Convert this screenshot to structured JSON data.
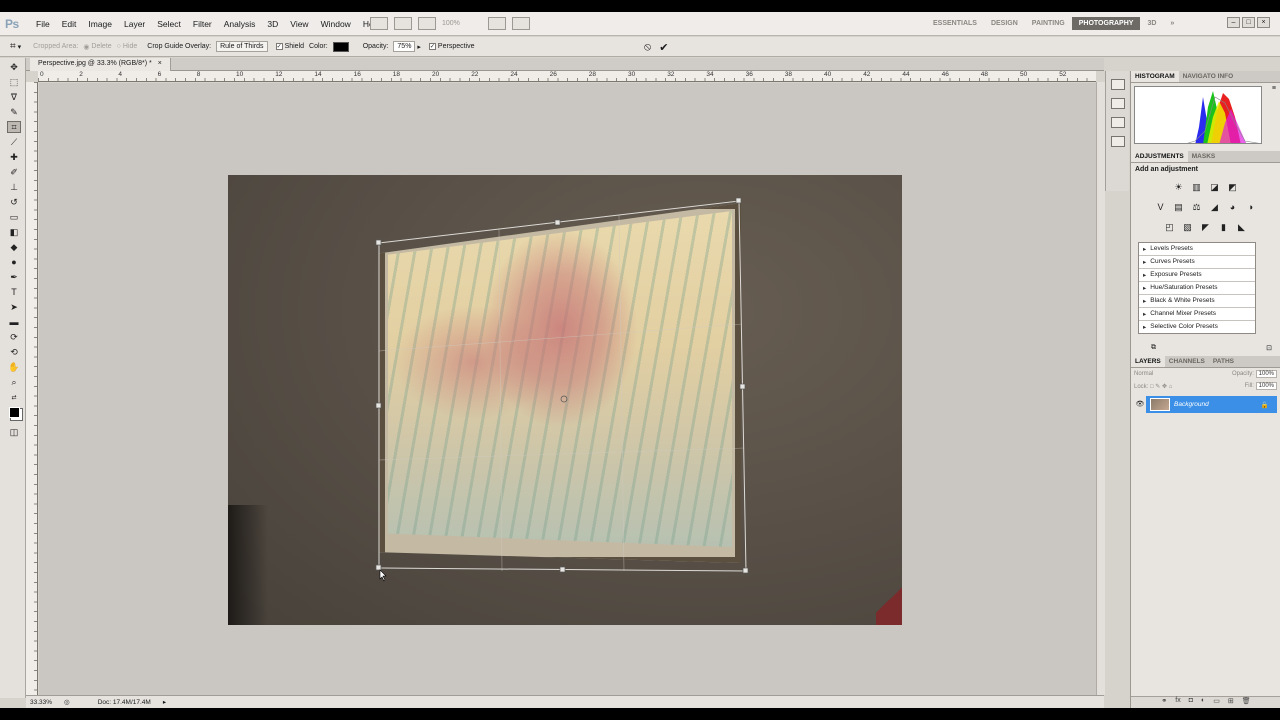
{
  "menubar": {
    "logo": "Ps",
    "items": [
      "File",
      "Edit",
      "Image",
      "Layer",
      "Select",
      "Filter",
      "Analysis",
      "3D",
      "View",
      "Window",
      "Help"
    ],
    "zoom": "100%",
    "workspaces": [
      "ESSENTIALS",
      "DESIGN",
      "PAINTING",
      "PHOTOGRAPHY",
      "3D"
    ],
    "active_workspace": "PHOTOGRAPHY",
    "more": "»"
  },
  "options": {
    "cropped_area_label": "Cropped Area:",
    "delete_label": "Delete",
    "hide_label": "Hide",
    "overlay_label": "Crop Guide Overlay:",
    "overlay_value": "Rule of Thirds",
    "shield_label": "Shield",
    "color_label": "Color:",
    "opacity_label": "Opacity:",
    "opacity_value": "75%",
    "perspective_label": "Perspective",
    "cancel_icon": "⦸",
    "commit_icon": "✔"
  },
  "document": {
    "tab_title": "Perspective.jpg @ 33.3% (RGB/8*) *",
    "close": "×",
    "zoom": "33.33%",
    "doc_info": "Doc: 17.4M/17.4M"
  },
  "ruler": {
    "marks": [
      "0",
      "2",
      "4",
      "6",
      "8",
      "10",
      "12",
      "14",
      "16",
      "18",
      "20",
      "22",
      "24",
      "26",
      "28",
      "30",
      "32",
      "34",
      "36",
      "38",
      "40",
      "42",
      "44",
      "46",
      "48",
      "50",
      "52"
    ]
  },
  "panels": {
    "histogram_tab": "HISTOGRAM",
    "navigator_tab": "NAVIGATO INFO",
    "adjustments_tab": "ADJUSTMENTS",
    "masks_tab": "MASKS",
    "add_adjustment": "Add an adjustment",
    "presets": [
      "Levels Presets",
      "Curves Presets",
      "Exposure Presets",
      "Hue/Saturation Presets",
      "Black & White Presets",
      "Channel Mixer Presets",
      "Selective Color Presets"
    ],
    "layers_tab": "LAYERS",
    "channels_tab": "CHANNELS",
    "paths_tab": "PATHS",
    "blend_mode": "Normal",
    "opacity_label": "Opacity:",
    "opacity_value": "100%",
    "lock_label": "Lock:",
    "fill_label": "Fill:",
    "fill_value": "100%",
    "layer_name": "Background"
  },
  "colors": {
    "accent": "#3b8fe6",
    "active_workspace_bg": "#6d6a66"
  }
}
